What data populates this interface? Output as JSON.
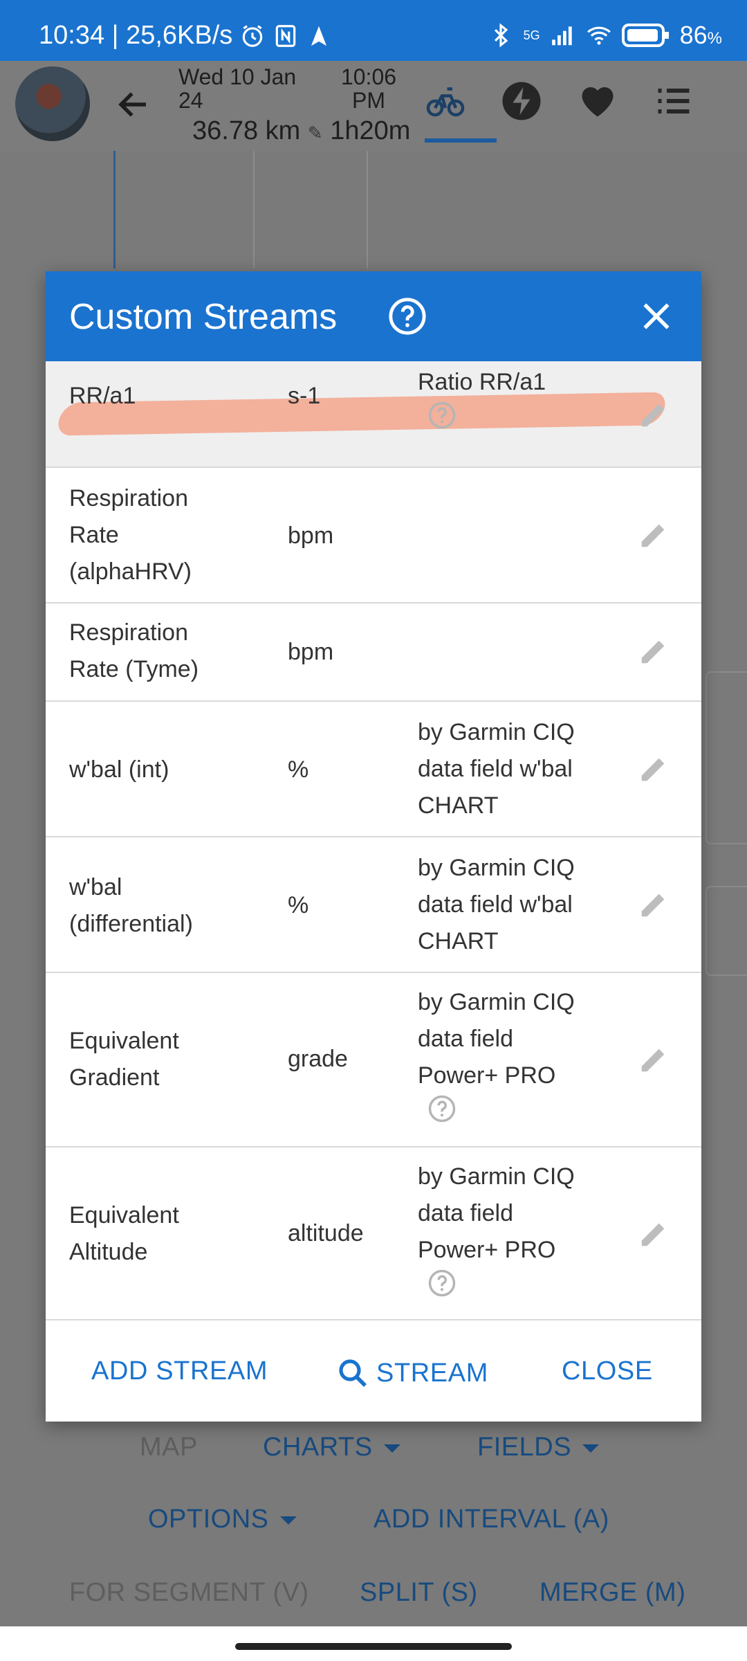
{
  "status_bar": {
    "left_text": "10:34 | 25,6KB/s",
    "battery": "86",
    "battery_unit": "%",
    "network": "5G",
    "icons": [
      "alarm-icon",
      "nfc-icon",
      "navigation-icon",
      "bluetooth-icon",
      "signal-icon",
      "wifi-icon",
      "battery-icon"
    ]
  },
  "app_header": {
    "date_line": "Wed 10 Jan 24",
    "time_line": "10:06 PM",
    "distance": "36.78 km",
    "duration": "1h20m",
    "tabs": [
      "bike-icon",
      "power-icon",
      "heart-icon",
      "list-icon"
    ],
    "accent_color": "#1a73cf"
  },
  "dialog": {
    "title": "Custom Streams",
    "rows": [
      {
        "name": "RR/a1",
        "unit": "s-1",
        "desc": "Ratio RR/a1",
        "has_help": true,
        "highlighted": true
      },
      {
        "name": "Respiration Rate (alphaHRV)",
        "unit": "bpm",
        "desc": "",
        "has_help": false
      },
      {
        "name": "Respiration Rate (Tyme)",
        "unit": "bpm",
        "desc": "",
        "has_help": false
      },
      {
        "name": "w'bal (int)",
        "unit": "%",
        "desc": "by Garmin CIQ data field w'bal CHART",
        "has_help": false
      },
      {
        "name": "w'bal (differential)",
        "unit": "%",
        "desc": "by Garmin CIQ data field w'bal CHART",
        "has_help": false
      },
      {
        "name": "Equivalent Gradient",
        "unit": "grade",
        "desc": "by Garmin CIQ data field Power+ PRO",
        "has_help": true
      },
      {
        "name": "Equivalent Altitude",
        "unit": "altitude",
        "desc": "by Garmin CIQ data field Power+ PRO",
        "has_help": true
      }
    ],
    "actions": {
      "add": "ADD STREAM",
      "search": "STREAM",
      "close": "CLOSE"
    }
  },
  "background_buttons": {
    "map": "MAP",
    "charts": "CHARTS",
    "fields": "FIELDS",
    "options": "OPTIONS",
    "add_interval": "ADD INTERVAL (A)",
    "for_segment": "FOR SEGMENT (V)",
    "split": "SPLIT (S)",
    "merge": "MERGE (M)"
  }
}
